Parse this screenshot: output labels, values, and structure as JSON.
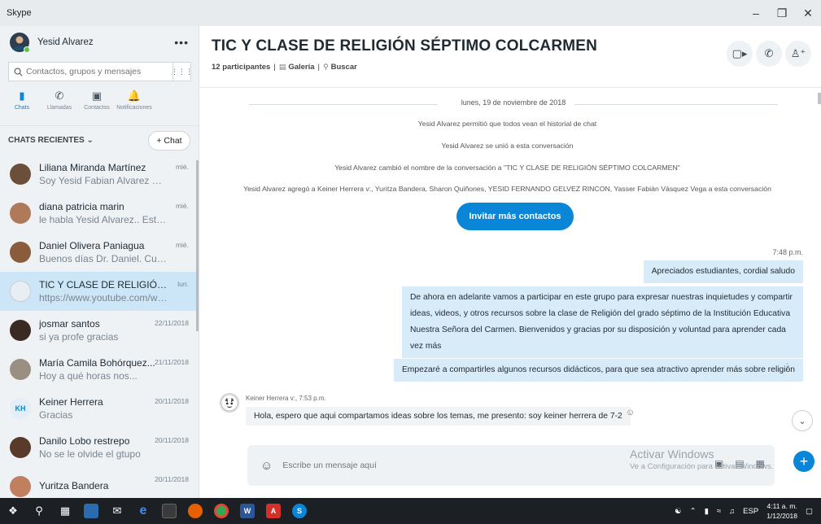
{
  "window": {
    "title": "Skype"
  },
  "profile": {
    "name": "Yesid Alvarez"
  },
  "search": {
    "placeholder": "Contactos, grupos y mensajes"
  },
  "nav": [
    {
      "label": "Chats",
      "icon": "chat-icon"
    },
    {
      "label": "Llamadas",
      "icon": "phone-icon"
    },
    {
      "label": "Contactos",
      "icon": "contacts-icon"
    },
    {
      "label": "Notificaciones",
      "icon": "bell-icon"
    }
  ],
  "sidebar": {
    "section_title": "CHATS RECIENTES",
    "new_chat_label": "+ Chat",
    "chats": [
      {
        "name": "Liliana Miranda Martínez",
        "preview": "Soy Yesid Fabian Alvarez Galezo...",
        "time": "mié."
      },
      {
        "name": "diana patricia marin",
        "preview": "le habla Yesid Alvarez.. Estudian...",
        "time": "mié."
      },
      {
        "name": "Daniel Olivera Paniagua",
        "preview": "Buenos días Dr. Daniel. Cuando...",
        "time": "mié."
      },
      {
        "name": "TIC Y CLASE DE RELIGIÓN...",
        "preview": "https://www.youtube.com/watc...",
        "time": "lun."
      },
      {
        "name": "josmar santos",
        "preview": "si ya profe gracias",
        "time": "22/11/2018"
      },
      {
        "name": "María Camila Bohórquez...",
        "preview": "Hoy a qué horas nos...",
        "time": "21/11/2018"
      },
      {
        "name": "Keiner Herrera",
        "preview": "Gracias",
        "time": "20/11/2018",
        "initials": "KH"
      },
      {
        "name": "Danilo Lobo restrepo",
        "preview": "No se le olvide el gtupo",
        "time": "20/11/2018"
      },
      {
        "name": "Yuritza Bandera",
        "preview": "",
        "time": "20/11/2018"
      }
    ]
  },
  "conversation": {
    "title": "TIC Y CLASE DE RELIGIÓN SÉPTIMO COLCARMEN",
    "participants": "12 participantes",
    "gallery": "Galería",
    "search": "Buscar",
    "date_separator": "lunes, 19 de noviembre de 2018",
    "system_messages": [
      "Yesid Alvarez permitió que todos vean el historial de chat",
      "Yesid Alvarez se unió a esta conversación",
      "Yesid Alvarez cambió el nombre de la conversación a \"TIC Y CLASE DE RELIGIÓN SÉPTIMO COLCARMEN\"",
      "Yesid Alvarez agregó a Keiner Herrera v:, Yuritza Bandera, Sharon Quiñones, YESID FERNANDO GELVEZ RINCON, Yasser Fabián Vásquez Vega a esta conversación"
    ],
    "invite_label": "Invitar más contactos",
    "out_time": "7:48 p.m.",
    "out_messages": [
      "Apreciados estudiantes, cordial saludo",
      "De ahora en adelante vamos a participar en este grupo para expresar nuestras inquietudes y compartir ideas, videos,  y otros recursos sobre la clase de Religión del grado séptimo de la Institución Educativa Nuestra Señora del Carmen. Bienvenidos y gracias por su disposición y voluntad para aprender cada vez más",
      "Empezaré a compartirles algunos recursos didácticos, para que sea atractivo aprender más sobre religión"
    ],
    "in_sender": "Keiner Herrera v:, 7:53 p.m.",
    "in_message": "Hola, espero que aqui compartamos ideas sobre los temas, me presento: soy keiner herrera de 7-2"
  },
  "composer": {
    "placeholder": "Escribe un mensaje aquí"
  },
  "watermark": {
    "line1": "Activar Windows",
    "line2": "Ve a Configuración para activar Windows."
  },
  "taskbar": {
    "lang": "ESP",
    "time": "4:11 a. m.",
    "date": "1/12/2018"
  },
  "colors": {
    "accent": "#0a86d9",
    "active_chat": "#cce6f7",
    "bubble_out": "#d7ebf8"
  }
}
